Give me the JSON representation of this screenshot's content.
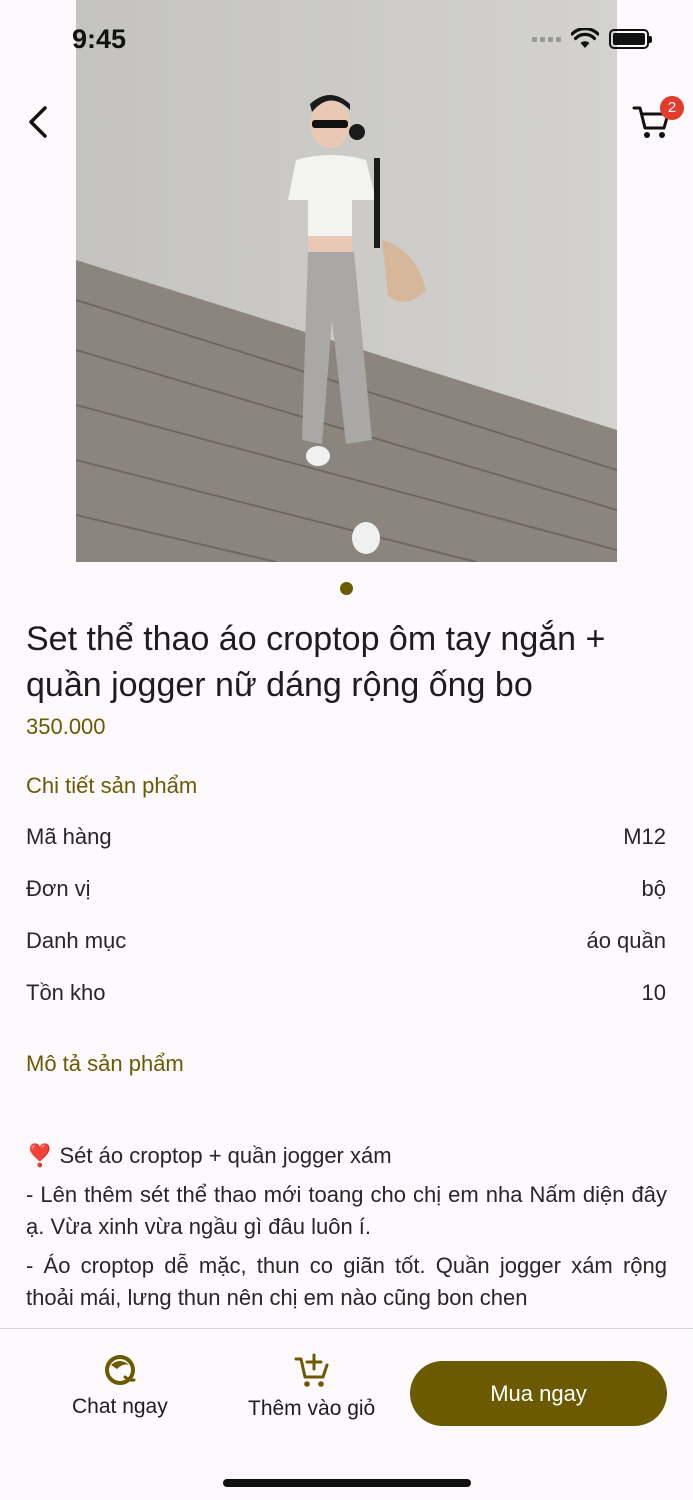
{
  "status": {
    "time": "9:45"
  },
  "header": {
    "cart_count": "2"
  },
  "product": {
    "title": "Set thể thao áo croptop ôm tay ngắn + quần jogger nữ dáng rộng ống bo",
    "price": "350.000"
  },
  "details": {
    "heading": "Chi tiết sản phẩm",
    "rows": [
      {
        "label": "Mã hàng",
        "value": "M12"
      },
      {
        "label": "Đơn vị",
        "value": "bộ"
      },
      {
        "label": "Danh mục",
        "value": "áo quần"
      },
      {
        "label": "Tồn kho",
        "value": "10"
      }
    ]
  },
  "description": {
    "heading": "Mô tả sản phẩm",
    "lines": [
      "❣️ Sét áo croptop + quần jogger xám",
      "- Lên thêm sét thể thao mới toang cho chị em nha Nấm diện đây ạ. Vừa xinh vừa ngầu gì đâu luôn í.",
      "- Áo croptop dễ mặc, thun co giãn tốt. Quần jogger xám rộng thoải mái, lưng thun nên chị em nào cũng bon chen"
    ]
  },
  "bottom": {
    "chat_label": "Chat ngay",
    "add_cart_label": "Thêm vào giỏ",
    "buy_label": "Mua ngay"
  },
  "colors": {
    "accent": "#6b5a00",
    "badge": "#e33b2e",
    "background": "#fdf9fc"
  }
}
